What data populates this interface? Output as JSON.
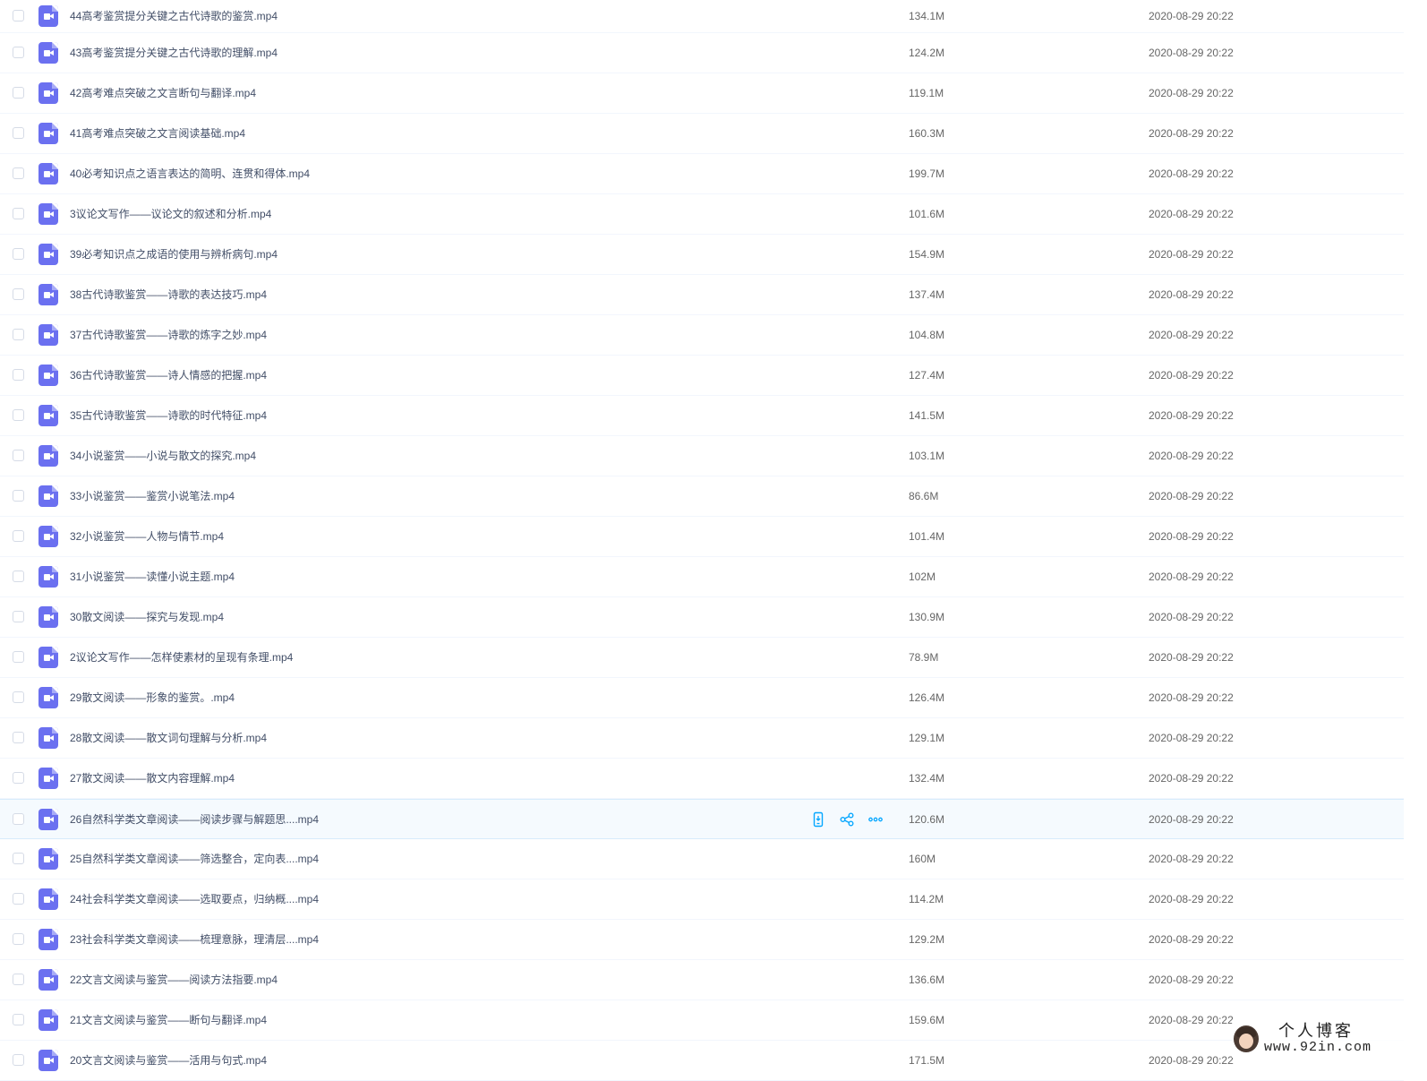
{
  "files": [
    {
      "name": "44高考鉴赏提分关键之古代诗歌的鉴赏.mp4",
      "size": "134.1M",
      "date": "2020-08-29 20:22"
    },
    {
      "name": "43高考鉴赏提分关键之古代诗歌的理解.mp4",
      "size": "124.2M",
      "date": "2020-08-29 20:22"
    },
    {
      "name": "42高考难点突破之文言断句与翻译.mp4",
      "size": "119.1M",
      "date": "2020-08-29 20:22"
    },
    {
      "name": "41高考难点突破之文言阅读基础.mp4",
      "size": "160.3M",
      "date": "2020-08-29 20:22"
    },
    {
      "name": "40必考知识点之语言表达的简明、连贯和得体.mp4",
      "size": "199.7M",
      "date": "2020-08-29 20:22"
    },
    {
      "name": "3议论文写作——议论文的叙述和分析.mp4",
      "size": "101.6M",
      "date": "2020-08-29 20:22"
    },
    {
      "name": "39必考知识点之成语的使用与辨析病句.mp4",
      "size": "154.9M",
      "date": "2020-08-29 20:22"
    },
    {
      "name": "38古代诗歌鉴赏——诗歌的表达技巧.mp4",
      "size": "137.4M",
      "date": "2020-08-29 20:22"
    },
    {
      "name": "37古代诗歌鉴赏——诗歌的炼字之妙.mp4",
      "size": "104.8M",
      "date": "2020-08-29 20:22"
    },
    {
      "name": "36古代诗歌鉴赏——诗人情感的把握.mp4",
      "size": "127.4M",
      "date": "2020-08-29 20:22"
    },
    {
      "name": "35古代诗歌鉴赏——诗歌的时代特征.mp4",
      "size": "141.5M",
      "date": "2020-08-29 20:22"
    },
    {
      "name": "34小说鉴赏——小说与散文的探究.mp4",
      "size": "103.1M",
      "date": "2020-08-29 20:22"
    },
    {
      "name": "33小说鉴赏——鉴赏小说笔法.mp4",
      "size": "86.6M",
      "date": "2020-08-29 20:22"
    },
    {
      "name": "32小说鉴赏——人物与情节.mp4",
      "size": "101.4M",
      "date": "2020-08-29 20:22"
    },
    {
      "name": "31小说鉴赏——读懂小说主题.mp4",
      "size": "102M",
      "date": "2020-08-29 20:22"
    },
    {
      "name": "30散文阅读——探究与发现.mp4",
      "size": "130.9M",
      "date": "2020-08-29 20:22"
    },
    {
      "name": "2议论文写作——怎样使素材的呈现有条理.mp4",
      "size": "78.9M",
      "date": "2020-08-29 20:22"
    },
    {
      "name": "29散文阅读——形象的鉴赏。.mp4",
      "size": "126.4M",
      "date": "2020-08-29 20:22"
    },
    {
      "name": "28散文阅读——散文词句理解与分析.mp4",
      "size": "129.1M",
      "date": "2020-08-29 20:22"
    },
    {
      "name": "27散文阅读——散文内容理解.mp4",
      "size": "132.4M",
      "date": "2020-08-29 20:22"
    },
    {
      "name": "26自然科学类文章阅读——阅读步骤与解题思....mp4",
      "size": "120.6M",
      "date": "2020-08-29 20:22",
      "hovered": true
    },
    {
      "name": "25自然科学类文章阅读——筛选整合，定向表....mp4",
      "size": "160M",
      "date": "2020-08-29 20:22"
    },
    {
      "name": "24社会科学类文章阅读——选取要点，归纳概....mp4",
      "size": "114.2M",
      "date": "2020-08-29 20:22"
    },
    {
      "name": "23社会科学类文章阅读——梳理意脉，理清层....mp4",
      "size": "129.2M",
      "date": "2020-08-29 20:22"
    },
    {
      "name": "22文言文阅读与鉴赏——阅读方法指要.mp4",
      "size": "136.6M",
      "date": "2020-08-29 20:22"
    },
    {
      "name": "21文言文阅读与鉴赏——断句与翻译.mp4",
      "size": "159.6M",
      "date": "2020-08-29 20:22"
    },
    {
      "name": "20文言文阅读与鉴赏——活用与句式.mp4",
      "size": "171.5M",
      "date": "2020-08-29 20:22"
    }
  ],
  "row_actions": [
    {
      "icon": "phone-download-icon"
    },
    {
      "icon": "share-icon"
    },
    {
      "icon": "more-icon"
    }
  ],
  "watermark": {
    "title": "个人博客",
    "url": "www.92in.com"
  },
  "colors": {
    "file_icon": "#6b70f0",
    "action_icon": "#06a7ff",
    "hover_row": "#f5fafe"
  }
}
